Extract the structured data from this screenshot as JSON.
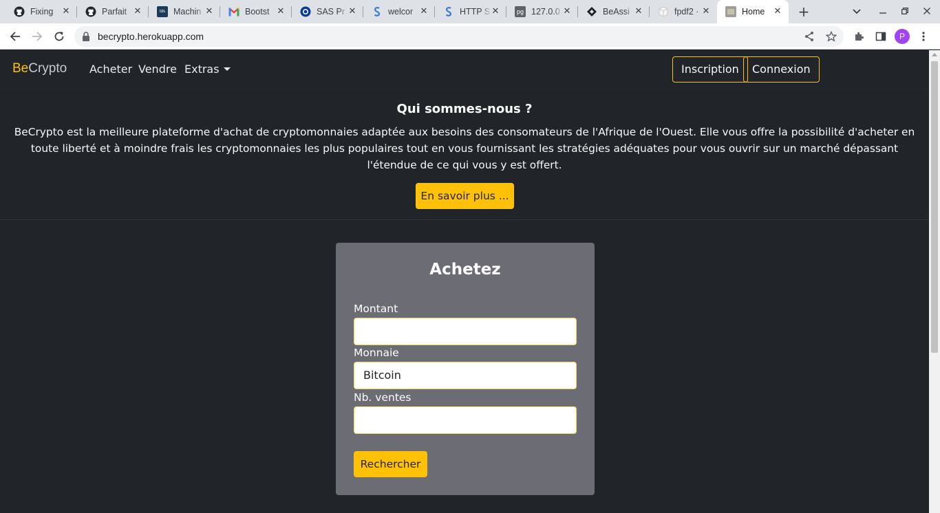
{
  "browser": {
    "tabs": [
      {
        "title": "Fixing",
        "icon": "github-icon"
      },
      {
        "title": "Parfait",
        "icon": "github-icon"
      },
      {
        "title": "Machin",
        "icon": "tds-icon",
        "icon_text": "tds"
      },
      {
        "title": "Bootst",
        "icon": "gmail-icon"
      },
      {
        "title": "SAS Pr",
        "icon": "sas-icon"
      },
      {
        "title": "welcor",
        "icon": "s-logo-icon"
      },
      {
        "title": "HTTP S",
        "icon": "s-logo-icon"
      },
      {
        "title": "127.0.0",
        "icon": "pg-icon",
        "icon_text": "pg"
      },
      {
        "title": "BeAssi",
        "icon": "diamond-icon"
      },
      {
        "title": "fpdf2 ·",
        "icon": "cube-icon"
      },
      {
        "title": "Home",
        "icon": "becrypto-favicon",
        "active": true
      }
    ],
    "url": "becrypto.herokuapp.com",
    "profile_initial": "P"
  },
  "site": {
    "brand_prefix": "Be",
    "brand_suffix": "Crypto",
    "nav": {
      "buy": "Acheter",
      "sell": "Vendre",
      "extras": "Extras"
    },
    "signup": "Inscription",
    "login": "Connexion"
  },
  "about": {
    "title": "Qui sommes-nous ?",
    "text": "BeCrypto est la meilleure plateforme d'achat de cryptomonnaies adaptée aux besoins des consomateurs de l'Afrique de l'Ouest. Elle vous offre la possibilité d'acheter en toute liberté et à moindre frais les cryptomonnaies les plus populaires tout en vous fournissant les stratégies adéquates pour vous ouvrir sur un marché dépassant l'étendue de ce qui vous y est offert.",
    "more_button": "En savoir plus ..."
  },
  "buy_form": {
    "title": "Achetez",
    "amount_label": "Montant",
    "amount_value": "",
    "currency_label": "Monnaie",
    "currency_value": "Bitcoin",
    "sales_label": "Nb. ventes",
    "sales_value": "",
    "submit": "Rechercher"
  },
  "colors": {
    "accent": "#ffc107",
    "background": "#212529",
    "card": "#6c6c74"
  }
}
